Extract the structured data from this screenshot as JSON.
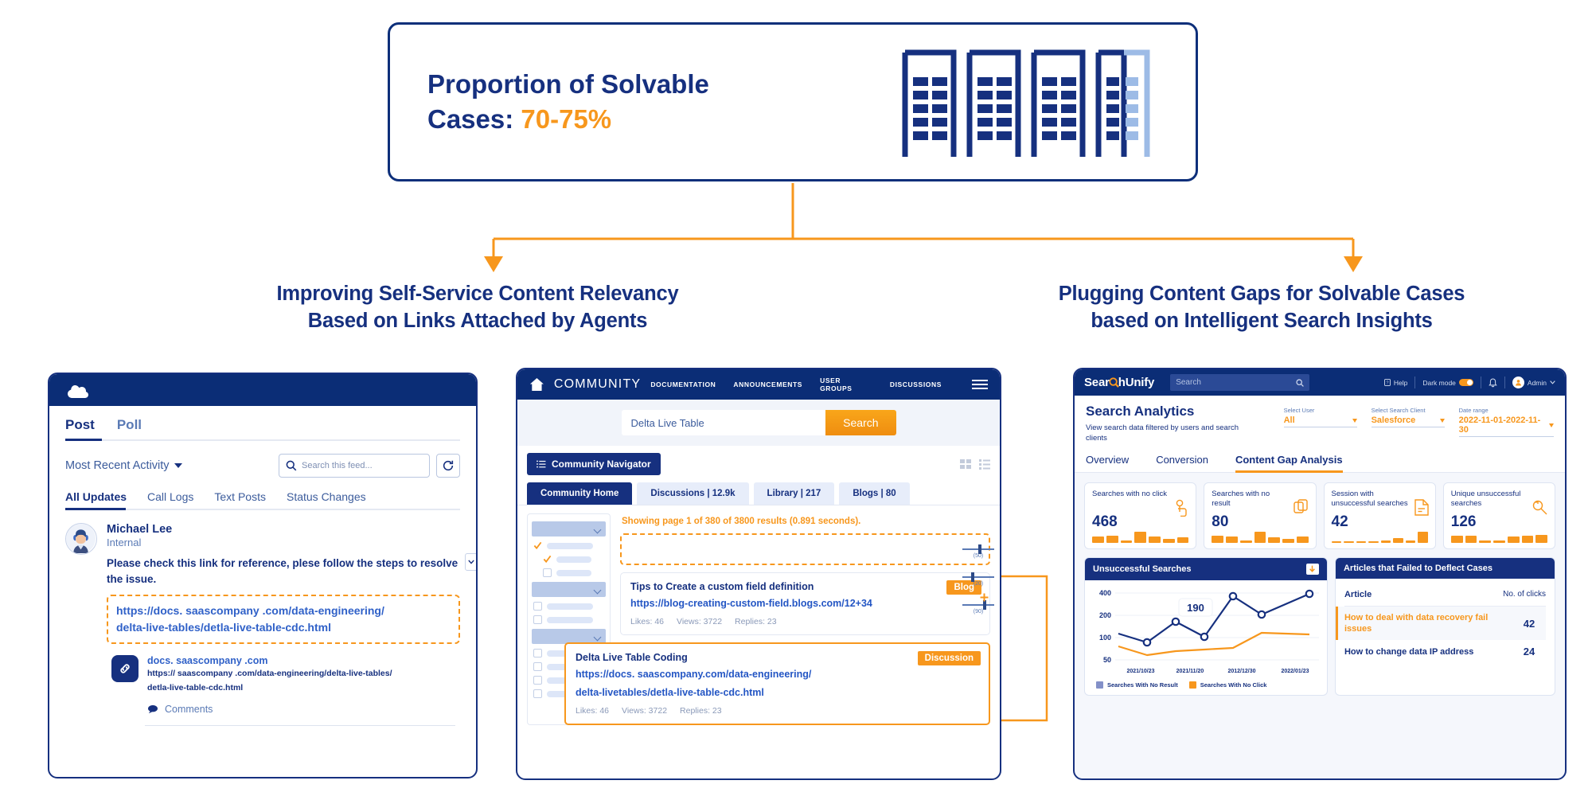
{
  "callout": {
    "line1": "Proportion of Solvable",
    "line2_prefix": "Cases: ",
    "line2_value": "70-75%"
  },
  "sections": {
    "left_heading_line1": "Improving Self-Service Content Relevancy",
    "left_heading_line2": "Based on Links Attached by Agents",
    "right_heading_line1": "Plugging Content Gaps for Solvable Cases",
    "right_heading_line2": "based on Intelligent Search Insights"
  },
  "salesforce": {
    "tabs": [
      "Post",
      "Poll"
    ],
    "sort_label": "Most Recent Activity",
    "search_placeholder": "Search this feed...",
    "subtabs": [
      "All Updates",
      "Call Logs",
      "Text Posts",
      "Status Changes"
    ],
    "post": {
      "author": "Michael Lee",
      "role": "Internal",
      "message": "Please check this link for reference, plese follow the steps to resolve the issue.",
      "highlighted_link_line1": "https://docs. saascompany .com/data-engineering/",
      "highlighted_link_line2": "delta-live-tables/detla-live-table-cdc.html",
      "preview_title": "docs. saascompany .com",
      "preview_url_line1": "https:// saascompany .com/data-engineering/delta-live-tables/",
      "preview_url_line2": "detla-live-table-cdc.html",
      "comments_label": "Comments"
    }
  },
  "community": {
    "brand": "COMMUNITY",
    "nav": [
      "DOCUMENTATION",
      "ANNOUNCEMENTS",
      "USER GROUPS",
      "DISCUSSIONS"
    ],
    "search_value": "Delta Live Table",
    "search_button": "Search",
    "navigator_button": "Community Navigator",
    "tabs": [
      "Community Home",
      "Discussions | 12.9k",
      "Library | 217",
      "Blogs | 80"
    ],
    "showing": "Showing page 1 of 380 of 3800 results (0.891 seconds).",
    "results": [
      {
        "title": "Tips to Create a custom field definition",
        "url": "https://blog-creating-custom-field.blogs.com/12+34",
        "badge": "Blog",
        "likes": "Likes: 46",
        "views": "Views: 3722",
        "replies": "Replies: 23"
      },
      {
        "title": "Delta Live Table Coding",
        "url_line1": "https://docs. saascompany.com/data-engineering/",
        "url_line2": "delta-livetables/detla-live-table-cdc.html",
        "badge": "Discussion",
        "likes": "Likes: 46",
        "views": "Views: 3722",
        "replies": "Replies: 23"
      }
    ],
    "sliders": [
      "(50)",
      "(20)",
      "(90)"
    ]
  },
  "searchunify": {
    "logo": "SearchUnify",
    "search_placeholder": "Search",
    "help_label": "Help",
    "dark_mode_label": "Dark mode",
    "user_label": "Admin",
    "page_title": "Search Analytics",
    "page_subtitle": "View search data filtered by users and search clients",
    "filters": [
      {
        "label": "Select User",
        "value": "All"
      },
      {
        "label": "Select Search Client",
        "value": "Salesforce"
      },
      {
        "label": "Date range",
        "value": "2022-11-01-2022-11-30"
      }
    ],
    "tabs": [
      "Overview",
      "Conversion",
      "Content Gap Analysis"
    ],
    "kpis": [
      {
        "label": "Searches with no click",
        "value": "468",
        "icon": "click-icon",
        "spark": [
          52,
          62,
          18,
          100,
          55,
          35,
          45
        ]
      },
      {
        "label": "Searches with no result",
        "value": "80",
        "icon": "copy-icon",
        "spark": [
          58,
          55,
          20,
          100,
          45,
          33,
          52
        ]
      },
      {
        "label": "Session with unsuccessful searches",
        "value": "42",
        "icon": "document-icon",
        "spark": [
          10,
          10,
          10,
          10,
          22,
          38,
          18,
          95
        ]
      },
      {
        "label": "Unique unsuccessful searches",
        "value": "126",
        "icon": "search-back-icon",
        "spark": [
          60,
          60,
          20,
          20,
          55,
          60,
          70
        ]
      }
    ],
    "chart_panel_title": "Unsuccessful Searches",
    "table_panel_title": "Articles that Failed to Deflect Cases",
    "table": {
      "columns": [
        "Article",
        "No. of clicks"
      ],
      "rows": [
        {
          "article": "How to deal with data recovery fail issues",
          "clicks": "42",
          "selected": true
        },
        {
          "article": "How to change data IP address",
          "clicks": "24",
          "selected": false
        }
      ]
    }
  },
  "chart_data": {
    "type": "line",
    "title": "Unsuccessful Searches",
    "xlabel": "",
    "ylabel": "",
    "x": [
      "2021/10/23",
      "2021/11/20",
      "2012/12/30",
      "2022/01/23"
    ],
    "xtick_positions": [
      0.08,
      0.33,
      0.6,
      0.87
    ],
    "ytick_labels": [
      "400",
      "200",
      "100",
      "50"
    ],
    "ytick_values": [
      400,
      200,
      100,
      50
    ],
    "annotation": {
      "text": "190",
      "x_index": 2
    },
    "grid": true,
    "legend_position": "bottom",
    "series": [
      {
        "name": "Searches With No Result",
        "color": "#16307f",
        "legend_color": "#8390c8",
        "values": [
          125,
          90,
          180,
          118,
          375,
          215,
          390
        ],
        "markers": [
          false,
          true,
          true,
          true,
          true,
          true,
          true
        ]
      },
      {
        "name": "Searches With No Click",
        "color": "#f7971d",
        "legend_color": "#f7971d",
        "values": [
          82,
          62,
          70,
          74,
          80,
          140,
          132
        ],
        "markers": [
          false,
          false,
          false,
          false,
          false,
          false,
          false
        ]
      }
    ]
  }
}
